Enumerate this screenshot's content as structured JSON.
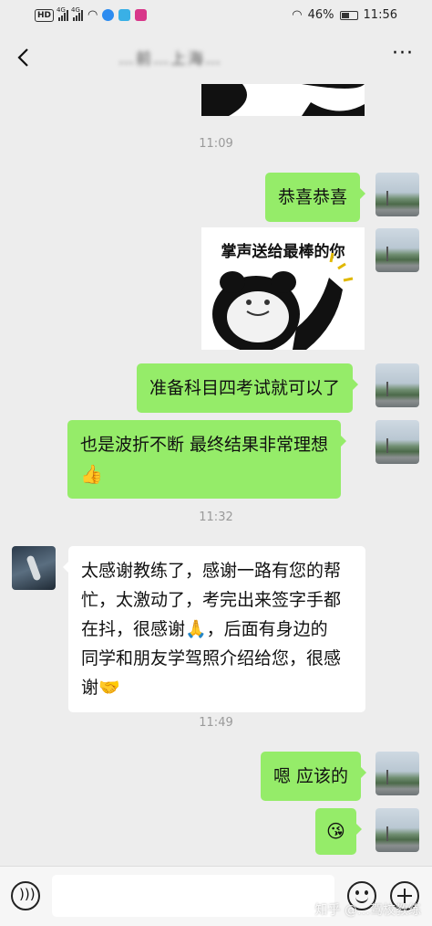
{
  "status_bar": {
    "hd": "HD",
    "network": "4G",
    "battery": "46%",
    "time": "11:56",
    "icons": [
      "signal-icon",
      "wifi-icon",
      "headphones-icon",
      "battery-icon"
    ]
  },
  "header": {
    "title": "…前…上海…",
    "back_icon": "chevron-left-icon",
    "more": "···"
  },
  "messages": {
    "t1": "11:09",
    "m1": "恭喜恭喜",
    "sticker1_caption": "掌声送给最棒的你",
    "m2": "准备科目四考试就可以了",
    "m3_line1": "也是波折不断 最终结果非常理想",
    "m3_emoji": "👍",
    "t2": "11:32",
    "r1_l1": "太感谢教练了，感谢一路有您的帮",
    "r1_l2": "忙，太激动了，考完出来签字手都",
    "r1_l3": "在抖，很感谢🙏，后面有身边的",
    "r1_l4": "同学和朋友学驾照介绍给您，很感",
    "r1_l5": "谢🤝",
    "t3": "11:49",
    "m4": "嗯 应该的",
    "m5": "😘"
  },
  "input_bar": {
    "voice_icon": "voice-icon",
    "emoji_icon": "smiley-icon",
    "plus_icon": "plus-icon"
  },
  "watermark": "知乎 @…驾校教练",
  "colors": {
    "background": "#ededed",
    "my_bubble": "#95ec69",
    "other_bubble": "#ffffff"
  }
}
